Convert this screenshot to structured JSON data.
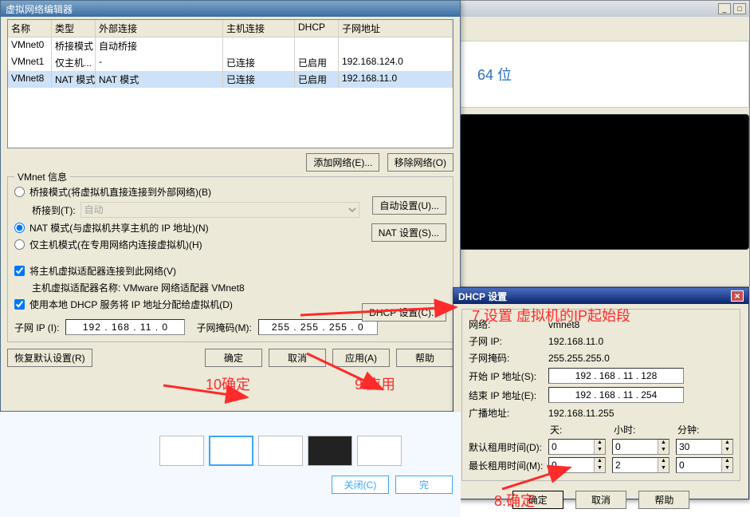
{
  "vne": {
    "title": "虚拟网络编辑器",
    "cols": {
      "name": "名称",
      "type": "类型",
      "ext": "外部连接",
      "host": "主机连接",
      "dhcp": "DHCP",
      "subnet": "子网地址"
    },
    "rows": [
      {
        "name": "VMnet0",
        "type": "桥接模式",
        "ext": "自动桥接",
        "host": "",
        "dhcp": "",
        "subnet": ""
      },
      {
        "name": "VMnet1",
        "type": "仅主机...",
        "ext": "-",
        "host": "已连接",
        "dhcp": "已启用",
        "subnet": "192.168.124.0"
      },
      {
        "name": "VMnet8",
        "type": "NAT 模式",
        "ext": "NAT 模式",
        "host": "已连接",
        "dhcp": "已启用",
        "subnet": "192.168.11.0"
      }
    ],
    "add_net": "添加网络(E)...",
    "remove_net": "移除网络(O)",
    "info_legend": "VMnet 信息",
    "rb_bridge": "桥接模式(将虚拟机直接连接到外部网络)(B)",
    "bridge_to": "桥接到(T):",
    "bridge_auto": "自动",
    "auto_set": "自动设置(U)...",
    "rb_nat": "NAT 模式(与虚拟机共享主机的 IP 地址)(N)",
    "nat_set": "NAT 设置(S)...",
    "rb_host": "仅主机模式(在专用网络内连接虚拟机)(H)",
    "cb_connect": "将主机虚拟适配器连接到此网络(V)",
    "adapter_label": "主机虚拟适配器名称: VMware 网络适配器 VMnet8",
    "cb_dhcp": "使用本地 DHCP 服务将 IP 地址分配给虚拟机(D)",
    "dhcp_set": "DHCP 设置(C)...",
    "subnet_ip_l": "子网 IP (I):",
    "subnet_ip_v": "192 . 168 . 11 . 0",
    "subnet_mask_l": "子网掩码(M):",
    "subnet_mask_v": "255 . 255 . 255 . 0",
    "restore": "恢复默认设置(R)",
    "ok": "确定",
    "cancel": "取消",
    "apply": "应用(A)",
    "help": "帮助"
  },
  "dhcp": {
    "title": "DHCP 设置",
    "net_l": "网络:",
    "net_v": "vmnet8",
    "sub_ip_l": "子网 IP:",
    "sub_ip_v": "192.168.11.0",
    "mask_l": "子网掩码:",
    "mask_v": "255.255.255.0",
    "start_l": "开始 IP 地址(S):",
    "start_v": "192 . 168 . 11 . 128",
    "end_l": "结束 IP 地址(E):",
    "end_v": "192 . 168 . 11 . 254",
    "bcast_l": "广播地址:",
    "bcast_v": "192.168.11.255",
    "days": "天:",
    "hours": "小时:",
    "mins": "分钟:",
    "def_lease_l": "默认租用时间(D):",
    "def_d": "0",
    "def_h": "0",
    "def_m": "30",
    "max_lease_l": "最长租用时间(M):",
    "max_d": "0",
    "max_h": "2",
    "max_m": "0",
    "ok": "确定",
    "cancel": "取消",
    "help": "帮助"
  },
  "bg": {
    "text": "64 位"
  },
  "strip": {
    "close": "关闭(C)",
    "complete": "完"
  },
  "anno": {
    "a7": "7.设置  虚拟机的IP起始段",
    "a8": "8.确定",
    "a9": "9.应用",
    "a10": "10确定"
  }
}
